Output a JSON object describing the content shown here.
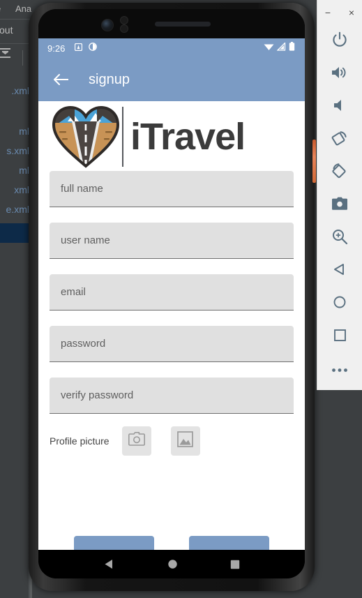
{
  "ide": {
    "menu_items": [
      "e",
      "Ana"
    ],
    "tab_label": "yout",
    "files": [
      ".xml",
      "ml",
      "s.xml",
      "ml",
      "xml",
      "e.xml"
    ],
    "sort_icon": "sort-icon"
  },
  "phone": {
    "statusbar": {
      "time": "9:26",
      "left_icons": [
        "notification-badge-icon",
        "clock-icon"
      ],
      "right_icons": [
        "wifi-icon",
        "cellular-signal-icon",
        "battery-icon"
      ]
    },
    "appbar": {
      "back_icon": "back-arrow-icon",
      "title": "signup"
    },
    "logo": {
      "wordmark": "iTravel",
      "mark_name": "itravel-heart-road-logo"
    },
    "form": {
      "fields": [
        {
          "name": "full-name",
          "placeholder": "full name",
          "value": ""
        },
        {
          "name": "user-name",
          "placeholder": "user name",
          "value": ""
        },
        {
          "name": "email",
          "placeholder": "email",
          "value": ""
        },
        {
          "name": "password",
          "placeholder": "password",
          "value": ""
        },
        {
          "name": "verify-password",
          "placeholder": "verify password",
          "value": ""
        }
      ],
      "profile_picture": {
        "label": "Profile picture",
        "camera_icon": "camera-icon",
        "gallery_icon": "gallery-image-icon"
      }
    },
    "actions": [
      {
        "name": "signup",
        "label": ""
      },
      {
        "name": "cancel",
        "label": ""
      }
    ],
    "navbar": {
      "back": "nav-back-triangle-icon",
      "home": "nav-home-circle-icon",
      "recents": "nav-recents-square-icon"
    }
  },
  "emulator_toolbar": {
    "minimize": "−",
    "close": "×",
    "buttons": [
      "power-icon",
      "volume-up-icon",
      "volume-down-icon",
      "rotate-left-icon",
      "rotate-right-icon",
      "screenshot-camera-icon",
      "zoom-in-icon",
      "back-triangle-icon",
      "home-circle-icon",
      "recents-square-icon",
      "more-ellipsis-icon"
    ]
  },
  "colors": {
    "appbar": "#7b9bc4",
    "field_bg": "#e0e0e0",
    "ide_bg": "#3c3f41",
    "file_text": "#6a8bb0",
    "toolbar_bg": "#f0f0f0",
    "toolbar_icon": "#5a7080"
  }
}
